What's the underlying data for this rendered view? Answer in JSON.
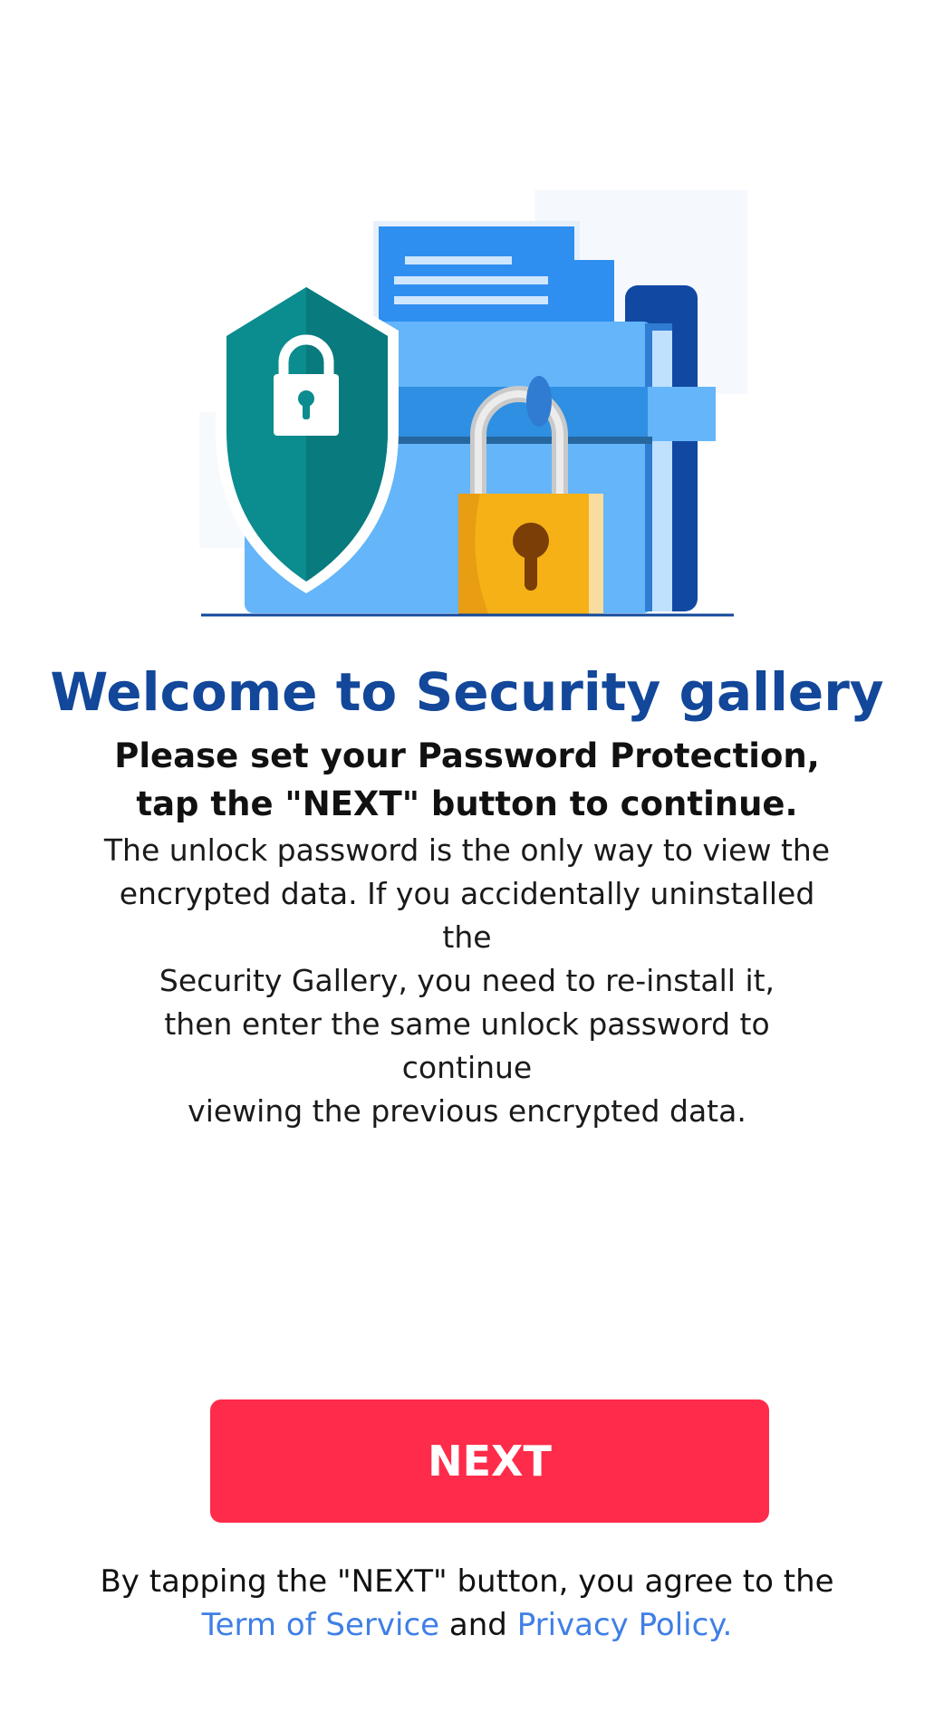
{
  "icons": {
    "illustration": "security-folder-illustration",
    "shield": "shield-lock-icon",
    "padlock": "padlock-icon"
  },
  "colors": {
    "title": "#12479a",
    "next_button": "#ff2b4a",
    "link": "#3f7fe6",
    "shield": "#0b8c8f",
    "padlock": "#f6b116",
    "folder": "#64b5f9"
  },
  "welcome": {
    "title": "Welcome to Security gallery",
    "subtitle_line1": "Please set your Password Protection,",
    "subtitle_line2": "tap the \"NEXT\" button to continue."
  },
  "info": {
    "line1": "The unlock password is the only way to view the",
    "line2": "encrypted data. If you accidentally uninstalled the",
    "line3": "Security Gallery, you need to re-install it,",
    "line4": "then enter the same unlock password to continue",
    "line5": "viewing the previous encrypted data."
  },
  "actions": {
    "next_label": "NEXT"
  },
  "agreement": {
    "line1": "By tapping the \"NEXT\" button, you agree to the",
    "terms_link": "Term of Service",
    "connector": " and ",
    "privacy_link": "Privacy Policy."
  }
}
